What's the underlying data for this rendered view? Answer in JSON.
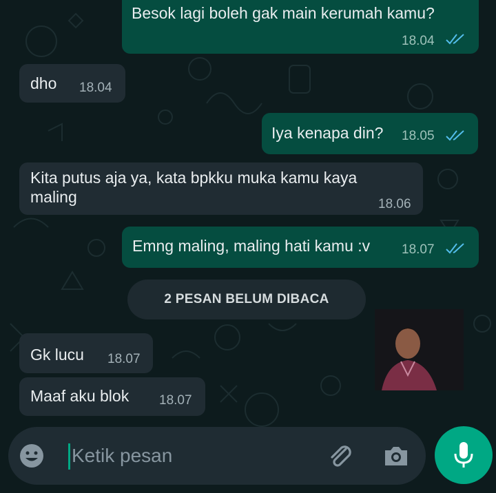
{
  "colors": {
    "outgoing_bubble": "#054d40",
    "incoming_bubble": "#202c33",
    "accent": "#00a884",
    "read_ticks": "#53bdeb"
  },
  "messages": [
    {
      "direction": "outgoing",
      "text": "Besok lagi boleh gak main kerumah kamu?",
      "time": "18.04",
      "status": "read"
    },
    {
      "direction": "incoming",
      "text": "dho",
      "time": "18.04"
    },
    {
      "direction": "outgoing",
      "text": "Iya kenapa din?",
      "time": "18.05",
      "status": "read"
    },
    {
      "direction": "incoming",
      "text": "Kita putus aja ya, kata bpkku muka kamu kaya maling",
      "time": "18.06"
    },
    {
      "direction": "outgoing",
      "text": "Emng maling, maling hati kamu :v",
      "time": "18.07",
      "status": "read"
    },
    {
      "direction": "incoming",
      "text": "Gk lucu",
      "time": "18.07"
    },
    {
      "direction": "incoming",
      "text": "Maaf aku blok",
      "time": "18.07"
    }
  ],
  "unread_divider": "2 PESAN BELUM DIBACA",
  "composer": {
    "placeholder": "Ketik pesan",
    "icons": [
      "emoji-icon",
      "attach-icon",
      "camera-icon",
      "mic-icon"
    ]
  }
}
